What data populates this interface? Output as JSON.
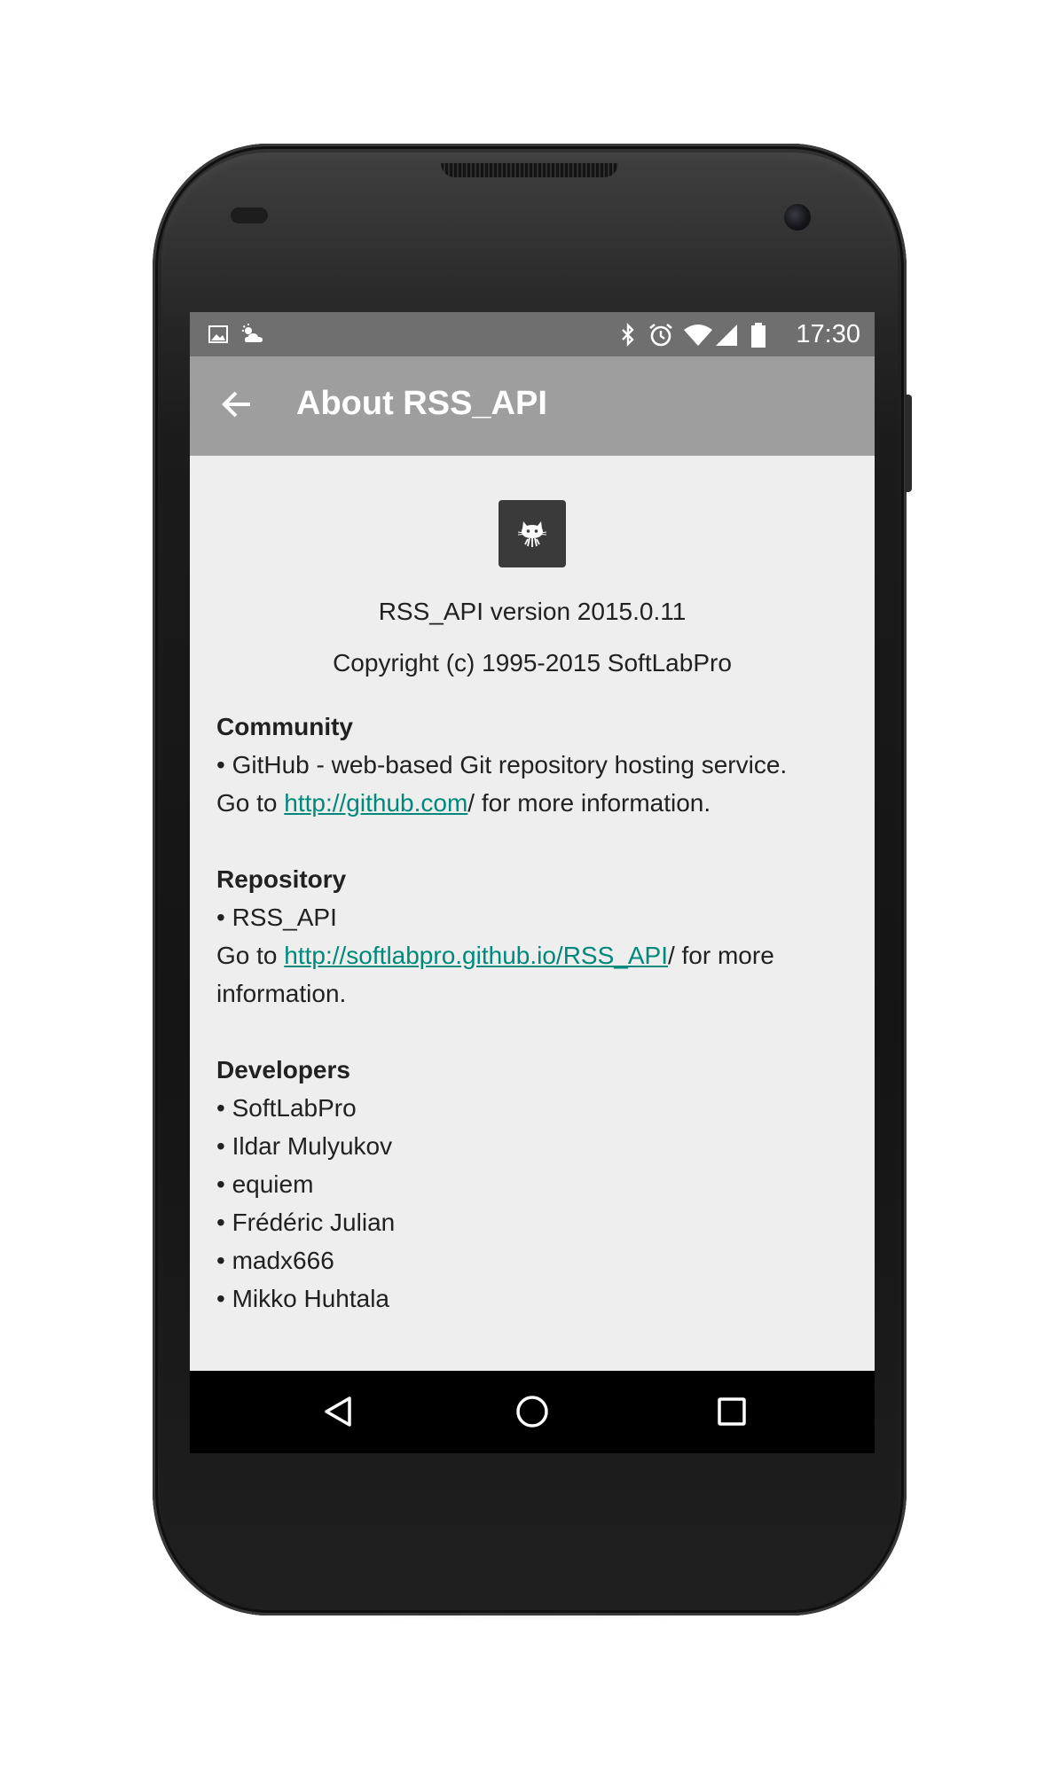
{
  "status_bar": {
    "time": "17:30",
    "left_icons": [
      "image-icon",
      "weather-cloud-icon"
    ],
    "right_icons": [
      "bluetooth-icon",
      "alarm-icon",
      "wifi-icon",
      "signal-icon",
      "battery-icon"
    ]
  },
  "app_bar": {
    "title": "About RSS_API",
    "back_icon": "arrow-back-icon"
  },
  "about": {
    "logo_icon": "github-octocat-icon",
    "version_line": "RSS_API version 2015.0.11",
    "copyright_line": "Copyright (c) 1995-2015 SoftLabPro"
  },
  "community": {
    "title": "Community",
    "item": "• GitHub - web-based Git repository hosting service.",
    "go_to": "Go to ",
    "link": "http://github.com",
    "suffix": "/ for more information."
  },
  "repository": {
    "title": "Repository",
    "item": "• RSS_API",
    "go_to": "Go to ",
    "link": "http://softlabpro.github.io/RSS_API",
    "suffix": "/ for more",
    "suffix_line2": "information."
  },
  "developers": {
    "title": "Developers",
    "items": [
      "• SoftLabPro",
      "• Ildar Mulyukov",
      "• equiem",
      "• Frédéric Julian",
      "• madx666",
      "• Mikko Huhtala"
    ]
  },
  "nav_bar": {
    "back_icon": "nav-back-triangle-icon",
    "home_icon": "nav-home-circle-icon",
    "recents_icon": "nav-recents-square-icon"
  },
  "colors": {
    "status_bar": "#6f6f6f",
    "app_bar": "#9e9e9e",
    "content_bg": "#eeeeee",
    "link": "#00897b",
    "nav_bar": "#000000"
  }
}
